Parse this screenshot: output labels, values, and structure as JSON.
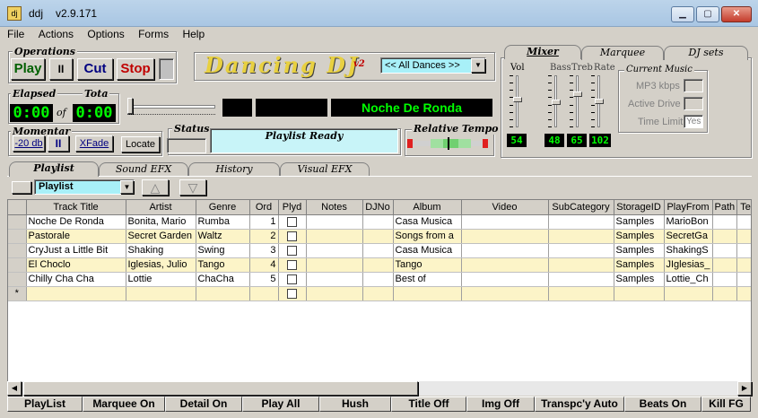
{
  "window": {
    "app_icon_text": "dj",
    "title": "ddj",
    "version": "v2.9.171",
    "minimize": "▁",
    "maximize": "▢",
    "close": "✕"
  },
  "menu": [
    "File",
    "Actions",
    "Options",
    "Forms",
    "Help"
  ],
  "operations": {
    "label": "Operations",
    "play": "Play",
    "pause": "II",
    "cut": "Cut",
    "stop": "Stop"
  },
  "logo": {
    "text": "Dancing DJ",
    "version": "v2"
  },
  "dance_select": {
    "value": "<< All Dances >>"
  },
  "elapsed": {
    "label": "Elapsed",
    "value": "0:00"
  },
  "total": {
    "label": "Tota",
    "of": "of",
    "value": "0:00"
  },
  "now_playing": "Noche De Ronda",
  "momentary": {
    "label": "Momentar",
    "minus20": "-20 db",
    "pause": "II",
    "xfade": "XFade"
  },
  "locate": "Locate",
  "status": {
    "label": "Status",
    "text": "Playlist Ready"
  },
  "tempo": {
    "label": "Relative Tempo"
  },
  "mixer": {
    "tabs": [
      "Mixer",
      "Marquee",
      "DJ sets"
    ],
    "vol_label": "Vol",
    "bass_label": "Bass",
    "treb_label": "Treb",
    "rate_label": "Rate",
    "vol_value": "54",
    "bass_value": "48",
    "treb_value": "65",
    "rate_value": "102",
    "vol_level": 0.54,
    "bass_level": 0.48,
    "treb_level": 0.65,
    "rate_level": 0.5,
    "current_music_label": "Current Music",
    "mp3_kbps": "MP3 kbps",
    "active_drive": "Active Drive",
    "time_limit": "Time Limit",
    "time_limit_value": "Yes"
  },
  "main_tabs": [
    "Playlist",
    "Sound EFX",
    "History",
    "Visual EFX"
  ],
  "playlist_select": {
    "value": "Playlist"
  },
  "grid": {
    "columns": [
      "Track Title",
      "Artist",
      "Genre",
      "Ord",
      "Plyd",
      "Notes",
      "DJNo",
      "Album",
      "Video",
      "SubCategory",
      "StorageID",
      "PlayFrom",
      "Path",
      "Te"
    ],
    "rows": [
      {
        "title": "Noche De Ronda",
        "artist": "Bonita, Mario",
        "genre": "Rumba",
        "ord": "1",
        "album": "Casa Musica",
        "storage": "Samples",
        "playfrom": "MarioBon"
      },
      {
        "title": " Pastorale",
        "artist": "Secret Garden",
        "genre": "Waltz",
        "ord": "2",
        "album": "Songs from a",
        "storage": "Samples",
        "playfrom": "SecretGa"
      },
      {
        "title": " CryJust a Little Bit",
        "artist": "Shaking",
        "genre": "Swing",
        "ord": "3",
        "album": "Casa Musica",
        "storage": "Samples",
        "playfrom": "ShakingS"
      },
      {
        "title": " El Choclo",
        "artist": "Iglesias, Julio",
        "genre": "Tango",
        "ord": "4",
        "album": "Tango",
        "storage": "Samples",
        "playfrom": "JIglesias_"
      },
      {
        "title": "Chilly Cha Cha",
        "artist": "Lottie",
        "genre": "ChaCha",
        "ord": "5",
        "album": "Best of",
        "storage": "Samples",
        "playfrom": "Lottie_Ch"
      }
    ],
    "new_row_marker": "*"
  },
  "bottom_buttons": [
    "PlayList",
    "Marquee On",
    "Detail On",
    "Play All",
    "Hush",
    "Title Off",
    "Img Off",
    "Transpc'y Auto",
    "Beats On",
    "Kill FG"
  ],
  "colors": {
    "led_green": "#00ff00",
    "status_bg": "#c8f4f8",
    "select_bg": "#a8f0f8",
    "row_alt": "#fcf4c8",
    "stop_red": "#c00000",
    "cut_blue": "#000080"
  }
}
